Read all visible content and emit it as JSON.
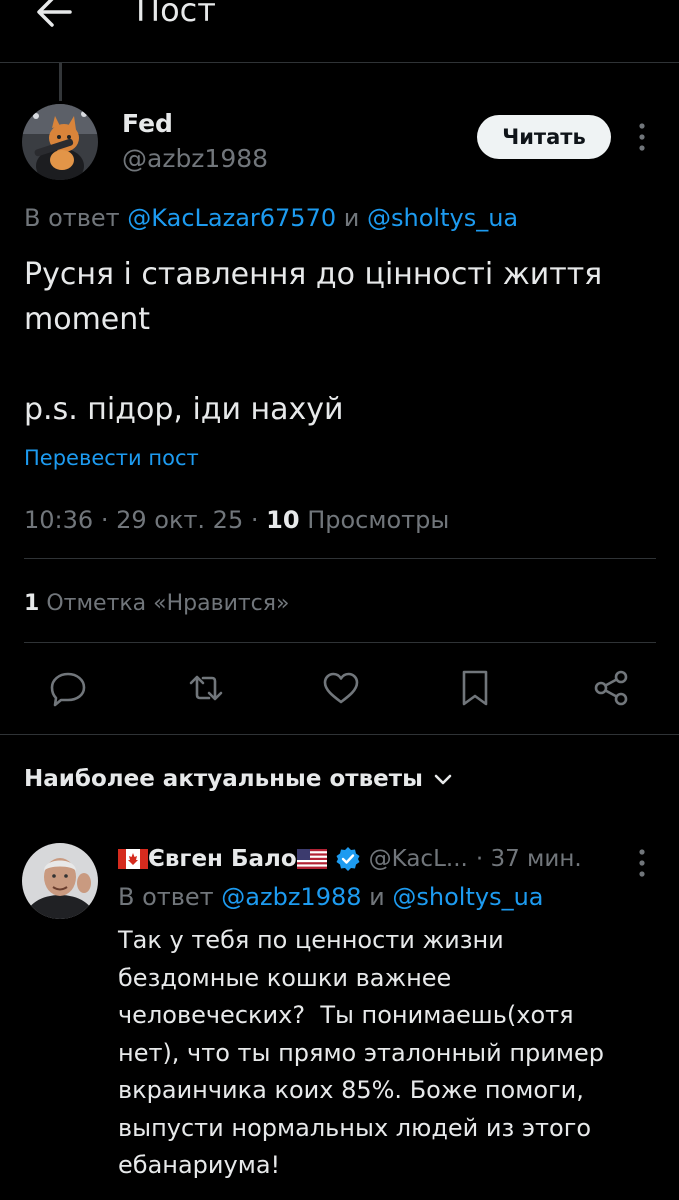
{
  "header": {
    "back_icon": "arrow-left-icon",
    "title": "Пост"
  },
  "post": {
    "author": {
      "name": "Fed",
      "handle": "@azbz1988",
      "follow_label": "Читать"
    },
    "reply_to": {
      "prefix": "В ответ",
      "user1": "@KacLazar67570",
      "joiner": "и",
      "user2": "@sholtys_ua"
    },
    "text": "Русня і ставлення до цінності життя\nmoment\n\np.s. підор, іди нахуй",
    "translate_label": "Перевести пост",
    "time": "10:36",
    "date": "29 окт. 25",
    "views_count": "10",
    "views_label": "Просмотры",
    "likes_count": "1",
    "likes_label": "Отметка «Нравится»",
    "actions": [
      {
        "name": "reply",
        "icon": "comment-icon"
      },
      {
        "name": "repost",
        "icon": "retweet-icon"
      },
      {
        "name": "like",
        "icon": "heart-icon"
      },
      {
        "name": "bookmark",
        "icon": "bookmark-icon"
      },
      {
        "name": "share",
        "icon": "share-icon"
      }
    ]
  },
  "replies_section": {
    "sort_label": "Наиболее актуальные ответы"
  },
  "reply": {
    "name": "Євген Бало",
    "handle": "@KacL...",
    "time": "· 37 мин.",
    "reply_to": {
      "prefix": "В ответ",
      "user1": "@azbz1988",
      "joiner": "и",
      "user2": "@sholtys_ua"
    },
    "text": "Так у тебя по ценности жизни\nбездомные кошки важнее\nчеловеческих?  Ты понимаешь(хотя\nнет), что ты прямо эталонный пример\nвкраинчика коих 85%. Боже помоги,\nвыпусти нормальных людей из этого\nебанариума!"
  },
  "colors": {
    "background": "#000000",
    "text": "#e7e9ea",
    "muted": "#71767b",
    "accent": "#1d9bf0",
    "divider": "#2f3336"
  }
}
